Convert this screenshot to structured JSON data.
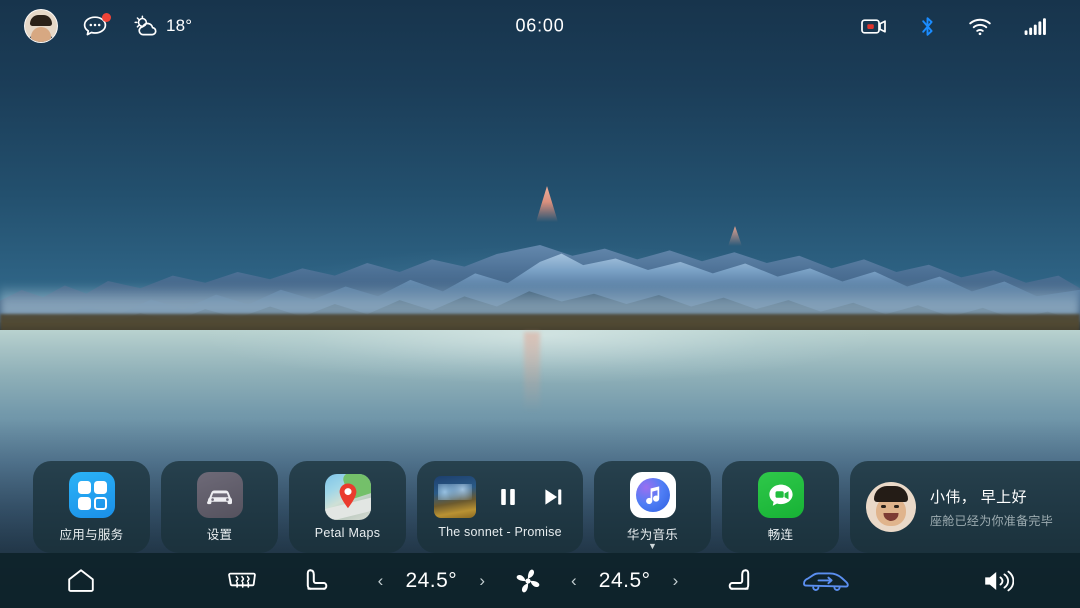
{
  "status_bar": {
    "avatar_name": "user-avatar",
    "messages_icon": "message-bubble-icon",
    "messages_badge": "",
    "weather_icon": "partly-cloudy-icon",
    "weather_temp": "18°",
    "clock": "06:00",
    "right_icons": [
      {
        "name": "dashcam-icon",
        "label": "dashcam"
      },
      {
        "name": "bluetooth-icon",
        "label": "bluetooth",
        "color": "#1a8cff"
      },
      {
        "name": "wifi-icon",
        "label": "wifi"
      },
      {
        "name": "cellular-signal-icon",
        "label": "signal"
      }
    ]
  },
  "dock": {
    "apps": [
      {
        "name": "app-apps-and-services",
        "label": "应用与服务",
        "icon": "apps-grid-icon"
      },
      {
        "name": "app-settings",
        "label": "设置",
        "icon": "car-front-icon"
      },
      {
        "name": "app-petal-maps",
        "label": "Petal Maps",
        "icon": "map-pin-icon"
      }
    ],
    "player": {
      "track": "The sonnet - Promise",
      "album_art": "album-art-thumbnail",
      "pause_label": "pause",
      "next_label": "next-track"
    },
    "music_app": {
      "label": "华为音乐",
      "icon": "music-note-icon",
      "chevron": "▼"
    },
    "meetime_app": {
      "label": "畅连",
      "icon": "video-chat-icon"
    },
    "assistant": {
      "avatar": "assistant-user-avatar",
      "greeting": "小伟， 早上好",
      "subtitle": "座舱已经为你准备完毕"
    }
  },
  "control_bar": {
    "home": "home-icon",
    "rear_defrost": "rear-defrost-icon",
    "seat_left": "seat-heat-left-icon",
    "temp_left": "24.5°",
    "fan": "fan-icon",
    "temp_right": "24.5°",
    "seat_right": "seat-heat-right-icon",
    "air_recirculation": "air-recirculation-icon",
    "volume": "volume-icon",
    "decrease": "‹",
    "increase": "›"
  },
  "colors": {
    "accent_blue": "#1a8cff",
    "badge_red": "#f04438",
    "card_bg": "rgba(26,48,56,0.74)",
    "bar_bg": "rgba(14,35,42,0.92)",
    "recirc_active": "#5b8ff0"
  }
}
